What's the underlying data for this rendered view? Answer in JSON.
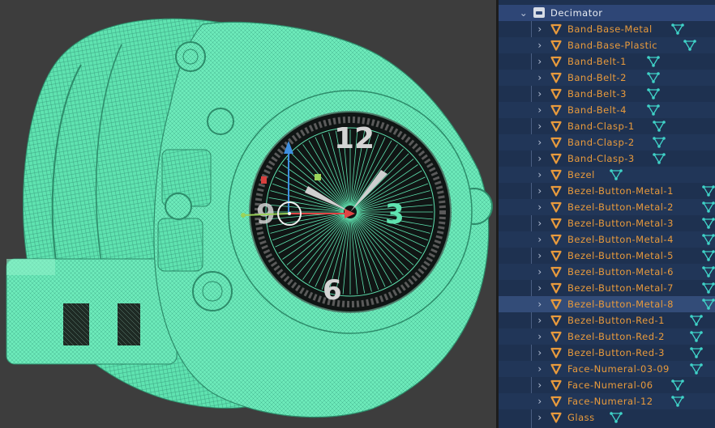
{
  "outliner": {
    "parent": {
      "label": "Decimator",
      "icon": "collection-icon",
      "expanded": true
    },
    "items": [
      {
        "label": "Band-Base-Metal"
      },
      {
        "label": "Band-Base-Plastic"
      },
      {
        "label": "Band-Belt-1"
      },
      {
        "label": "Band-Belt-2"
      },
      {
        "label": "Band-Belt-3"
      },
      {
        "label": "Band-Belt-4"
      },
      {
        "label": "Band-Clasp-1"
      },
      {
        "label": "Band-Clasp-2"
      },
      {
        "label": "Band-Clasp-3"
      },
      {
        "label": "Bezel"
      },
      {
        "label": "Bezel-Button-Metal-1"
      },
      {
        "label": "Bezel-Button-Metal-2"
      },
      {
        "label": "Bezel-Button-Metal-3"
      },
      {
        "label": "Bezel-Button-Metal-4"
      },
      {
        "label": "Bezel-Button-Metal-5"
      },
      {
        "label": "Bezel-Button-Metal-6"
      },
      {
        "label": "Bezel-Button-Metal-7"
      },
      {
        "label": "Bezel-Button-Metal-8",
        "selected": true
      },
      {
        "label": "Bezel-Button-Red-1"
      },
      {
        "label": "Bezel-Button-Red-2"
      },
      {
        "label": "Bezel-Button-Red-3"
      },
      {
        "label": "Face-Numeral-03-09"
      },
      {
        "label": "Face-Numeral-06"
      },
      {
        "label": "Face-Numeral-12"
      },
      {
        "label": "Glass"
      }
    ],
    "colors": {
      "object_label": "#e89a3c",
      "modifier_icon": "#e89a3c",
      "mesh_data_icon": "#3fd3c8",
      "background": "#1e3150",
      "selected_row": "#334c78"
    }
  },
  "viewport": {
    "mode": "wireframe",
    "colors": {
      "mesh": "#5fe3b0",
      "background": "#3d3d3d"
    },
    "dial_numerals": [
      "12",
      "3",
      "6",
      "9"
    ]
  }
}
